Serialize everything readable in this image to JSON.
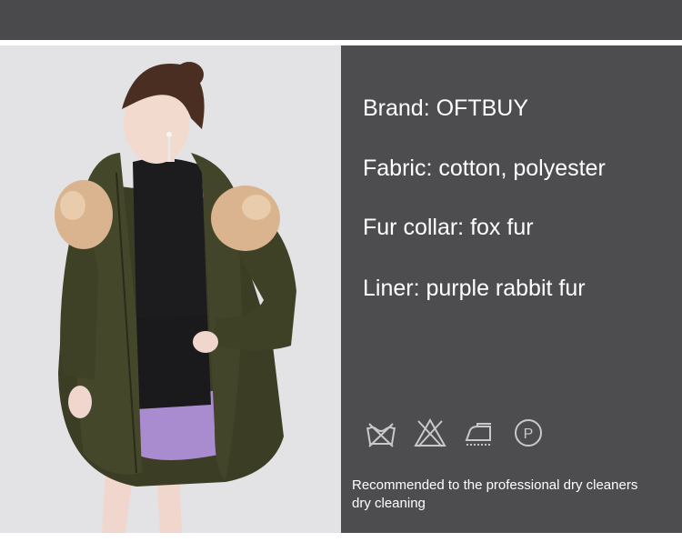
{
  "specs": {
    "brand": "Brand: OFTBUY",
    "fabric": "Fabric: cotton, polyester",
    "collar": "Fur collar: fox fur",
    "liner": "Liner: purple rabbit fur"
  },
  "care": {
    "icons": [
      "do-not-wash-icon",
      "do-not-bleach-icon",
      "iron-icon",
      "dry-clean-p-icon"
    ],
    "p_symbol": "P",
    "line1": "Recommended to the professional dry cleaners",
    "line2": "dry cleaning"
  },
  "colors": {
    "panel": "#4d4d4f",
    "top_band": "#4a4a4c",
    "text": "#ffffff",
    "icon_stroke": "#c9c9cb",
    "coat": "#3f4127",
    "liner": "#a98cd0",
    "fur": "#d9b48f"
  }
}
